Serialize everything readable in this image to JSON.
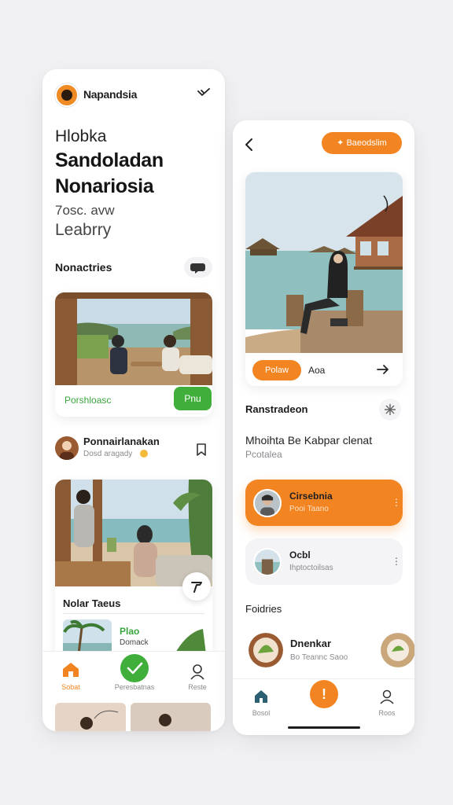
{
  "colors": {
    "accent": "#f28522",
    "green": "#3fae3a",
    "text": "#1f1f22",
    "muted": "#8a8a8f"
  },
  "left": {
    "brand": "Napandsia",
    "header_icon": "chevron-check-icon",
    "headline_small": "Hlobka",
    "headline_line1": "Sandoladan",
    "headline_line2": "Nonariosia",
    "subline1": "7osc. avw",
    "subline2": "Leabrry",
    "section1_title": "Nonactries",
    "card1": {
      "caption": "Porshloasc",
      "button": "Pnu"
    },
    "user": {
      "name": "Ponnairlanakan",
      "meta": "Dosd aragady"
    },
    "card2": {
      "title": "Nolar Taeus"
    },
    "mini": {
      "title": "Plao",
      "sub": "Domack"
    },
    "tabs": [
      {
        "label": "Sobat",
        "icon": "home-icon"
      },
      {
        "label": "Peresbatnas",
        "icon": "check-circle-icon"
      },
      {
        "label": "Reste",
        "icon": "profile-icon"
      }
    ]
  },
  "right": {
    "top_button": "Baeodslim",
    "hero": {
      "button": "Polaw",
      "label": "Aoa"
    },
    "section_title": "Ranstradeon",
    "headline": "Mhoihta Be Kabpar clenat",
    "subhead": "Pcotalea",
    "list": [
      {
        "name": "Cirsebnia",
        "sub": "Pooi Taano"
      },
      {
        "name": "Ocbl",
        "sub": "Ihptoctoilsas"
      }
    ],
    "section2_title": "Foidries",
    "food": {
      "name": "Dnenkar",
      "meta": "Bo Teannc Saoo"
    },
    "tabs": [
      {
        "label": "Bosol",
        "icon": "home-icon"
      },
      {
        "label": "",
        "icon": "alert-icon"
      },
      {
        "label": "Roos",
        "icon": "profile-icon"
      }
    ]
  }
}
